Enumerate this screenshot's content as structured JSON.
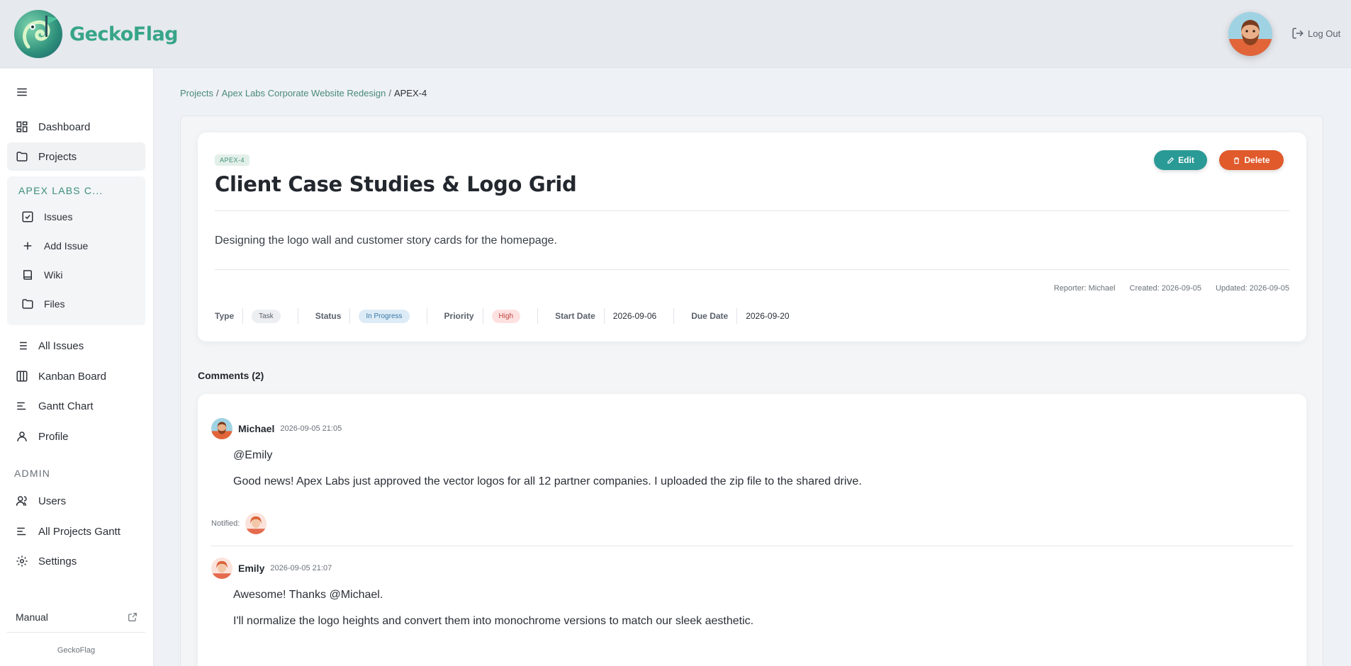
{
  "app": {
    "name": "GeckoFlag",
    "logout_label": "Log Out"
  },
  "sidebar": {
    "items": [
      {
        "label": "Dashboard",
        "icon": "dashboard-icon"
      },
      {
        "label": "Projects",
        "icon": "folder-icon"
      }
    ],
    "project_group": {
      "title": "APEX LABS C...",
      "items": [
        {
          "label": "Issues",
          "icon": "checkbox-icon"
        },
        {
          "label": "Add Issue",
          "icon": "plus-icon"
        },
        {
          "label": "Wiki",
          "icon": "book-icon"
        },
        {
          "label": "Files",
          "icon": "folder-icon"
        }
      ]
    },
    "items2": [
      {
        "label": "All Issues",
        "icon": "list-icon"
      },
      {
        "label": "Kanban Board",
        "icon": "kanban-icon"
      },
      {
        "label": "Gantt Chart",
        "icon": "gantt-icon"
      },
      {
        "label": "Profile",
        "icon": "user-icon"
      }
    ],
    "admin_label": "ADMIN",
    "admin_items": [
      {
        "label": "Users",
        "icon": "users-icon"
      },
      {
        "label": "All Projects Gantt",
        "icon": "gantt-icon"
      },
      {
        "label": "Settings",
        "icon": "gear-icon"
      }
    ],
    "manual_label": "Manual",
    "footer": "GeckoFlag"
  },
  "breadcrumb": {
    "projects": "Projects",
    "project": "Apex Labs Corporate Website Redesign",
    "current": "APEX-4"
  },
  "issue": {
    "key": "APEX-4",
    "title": "Client Case Studies & Logo Grid",
    "edit_label": "Edit",
    "delete_label": "Delete",
    "description": "Designing the logo wall and customer story cards for the homepage.",
    "reporter": "Reporter: Michael",
    "created": "Created: 2026-09-05",
    "updated": "Updated: 2026-09-05",
    "type_label": "Type",
    "type": "Task",
    "status_label": "Status",
    "status": "In Progress",
    "priority_label": "Priority",
    "priority": "High",
    "start_label": "Start Date",
    "start": "2026-09-06",
    "due_label": "Due Date",
    "due": "2026-09-20"
  },
  "comments": {
    "title": "Comments (2)",
    "notified_label": "Notified:",
    "list": [
      {
        "author": "Michael",
        "time": "2026-09-05 21:05",
        "line1": "@Emily",
        "line2": "Good news! Apex Labs just approved the vector logos for all 12 partner companies. I uploaded the zip file to the shared drive."
      },
      {
        "author": "Emily",
        "time": "2026-09-05 21:07",
        "line1": "Awesome! Thanks @Michael.",
        "line2": "I'll normalize the logo heights and convert them into monochrome versions to match our sleek aesthetic."
      }
    ]
  },
  "colors": {
    "brand": "#37a589",
    "edit": "#2a9a96",
    "delete": "#e05a2b",
    "status": "#3b79a8",
    "priority": "#c0443f"
  }
}
